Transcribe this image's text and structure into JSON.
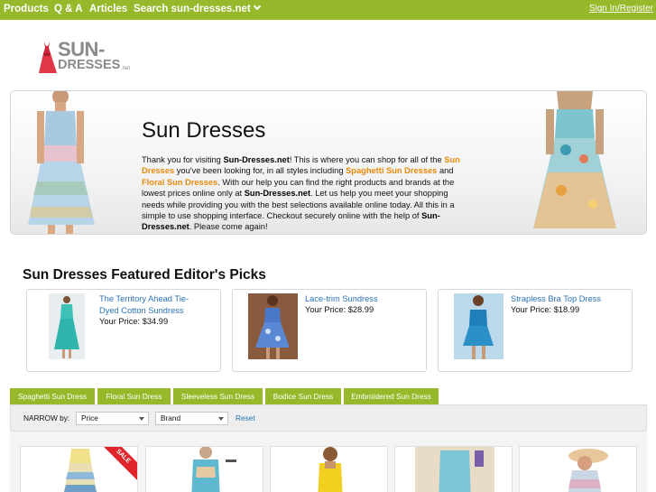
{
  "nav": {
    "items": [
      "Products",
      "Q & A",
      "Articles",
      "Search sun-dresses.net"
    ],
    "signin": "Sign In/Register"
  },
  "logo": {
    "sun": "SUN-",
    "dresses": "DRESSES",
    "net": ".net"
  },
  "banner": {
    "title": "Sun Dresses",
    "p1": "Thank you for visiting ",
    "site1": "Sun-Dresses.net",
    "p2": "! This is where you can shop for all of the ",
    "link1": "Sun Dresses",
    "p3": " you've been looking for, in all styles including ",
    "link2": "Spaghetti Sun Dresses",
    "p4": " and ",
    "link3": "Floral Sun Dresses",
    "p5": ". With our help you can find the right products and brands at the lowest prices online only at ",
    "site2": "Sun-Dresses.net",
    "p6": ". Let us help you meet your shopping needs while providing you with the best selections available online today. All this in a simple to use shopping interface. Checkout securely online with the help of ",
    "site3": "Sun-Dresses.net",
    "p7": ". Please come again!"
  },
  "featured": {
    "title": "Sun Dresses Featured Editor's Picks",
    "picks": [
      {
        "name": "The Territory Ahead Tie-Dyed Cotton Sundress",
        "price": "Your Price: $34.99"
      },
      {
        "name": "Lace-trim Sundress",
        "price": "Your Price: $28.99"
      },
      {
        "name": "Strapless Bra Top Dress",
        "price": "Your Price: $18.99"
      }
    ]
  },
  "tabs": [
    "Spaghetti Sun Dress",
    "Floral Sun Dress",
    "Sleeveless Sun Dress",
    "Bodice Sun Dress",
    "Embroidered Sun Dress"
  ],
  "narrow": {
    "label": "NARROW by:",
    "price": "Price",
    "brand": "Brand",
    "reset": "Reset"
  },
  "grid": {
    "sale": "SALE"
  },
  "colors": {
    "accent": "#97b82a",
    "link": "#2a73b8",
    "highlight": "#e88a0c",
    "sale": "#e0262c"
  },
  "icons": [
    "chevron-down-icon",
    "dress-logo-icon"
  ]
}
